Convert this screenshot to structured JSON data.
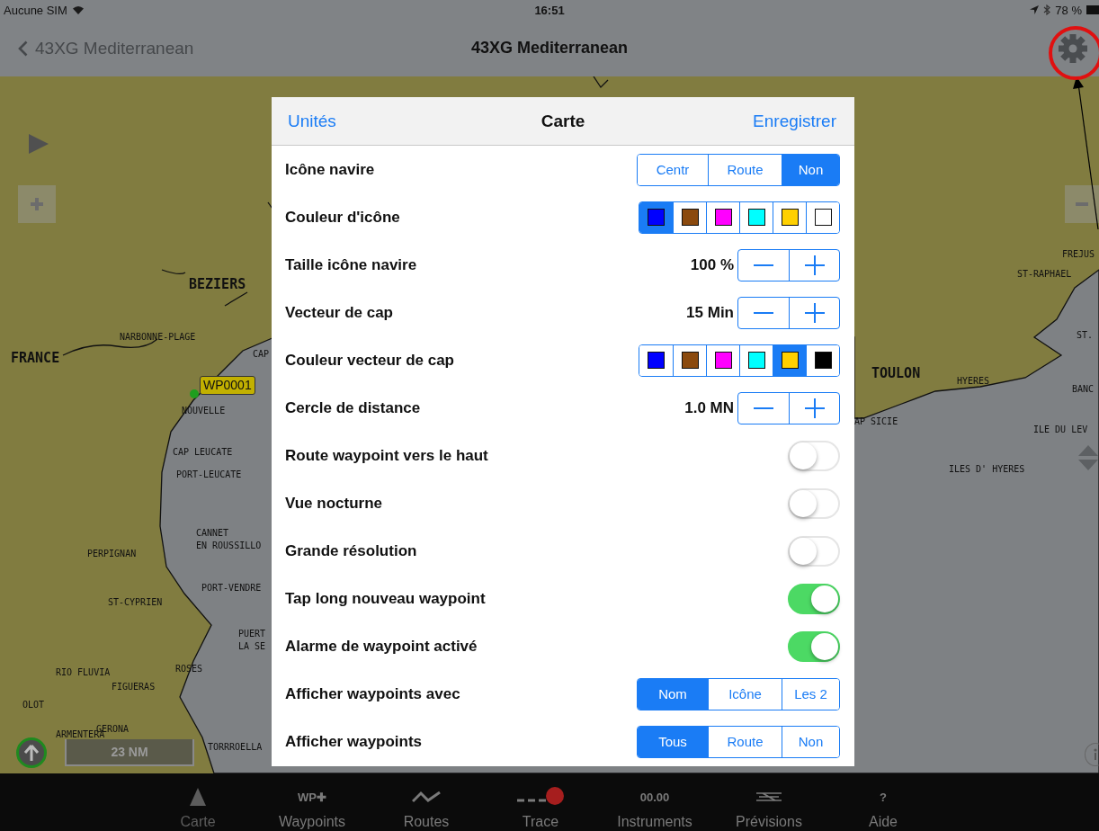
{
  "status_bar": {
    "carrier": "Aucune SIM",
    "time": "16:51",
    "battery": "78 %"
  },
  "nav_bar": {
    "back_label": "43XG Mediterranean",
    "title": "43XG Mediterranean"
  },
  "map": {
    "labels": [
      {
        "text": "BEZIERS",
        "kind": "city"
      },
      {
        "text": "NARBONNE-PLAGE",
        "kind": "place"
      },
      {
        "text": "FRANCE",
        "kind": "city"
      },
      {
        "text": "CAP",
        "kind": "place"
      },
      {
        "text": "NOUVELLE",
        "kind": "place"
      },
      {
        "text": "CAP LEUCATE",
        "kind": "place"
      },
      {
        "text": "PORT-LEUCATE",
        "kind": "place"
      },
      {
        "text": "CANNET",
        "kind": "place"
      },
      {
        "text": "EN ROUSSILLO",
        "kind": "place"
      },
      {
        "text": "PERPIGNAN",
        "kind": "place"
      },
      {
        "text": "PORT-VENDRE",
        "kind": "place"
      },
      {
        "text": "ST-CYPRIEN",
        "kind": "place"
      },
      {
        "text": "PUERT",
        "kind": "place"
      },
      {
        "text": "LA SE",
        "kind": "place"
      },
      {
        "text": "RIO FLUVIA",
        "kind": "place"
      },
      {
        "text": "FIGUERAS",
        "kind": "place"
      },
      {
        "text": "ROSES",
        "kind": "place"
      },
      {
        "text": "OLOT",
        "kind": "place"
      },
      {
        "text": "ARMENTERA",
        "kind": "place"
      },
      {
        "text": "GERONA",
        "kind": "place"
      },
      {
        "text": "TORRROELLA",
        "kind": "place"
      },
      {
        "text": "FREJUS",
        "kind": "place"
      },
      {
        "text": "ST-RAPHAEL",
        "kind": "place"
      },
      {
        "text": "ST.",
        "kind": "place"
      },
      {
        "text": "TOULON",
        "kind": "city"
      },
      {
        "text": "HYERES",
        "kind": "place"
      },
      {
        "text": "BANC",
        "kind": "place"
      },
      {
        "text": "AP SICIE",
        "kind": "place"
      },
      {
        "text": "ILE DU LEV",
        "kind": "place"
      },
      {
        "text": "ILES D' HYERES",
        "kind": "place"
      }
    ],
    "waypoint": "WP0001",
    "scale": "23 NM"
  },
  "popover": {
    "left_button": "Unités",
    "title": "Carte",
    "right_button": "Enregistrer",
    "rows": [
      {
        "kind": "segmented",
        "label": "Icône navire",
        "options": [
          {
            "label": "Centr",
            "selected": false
          },
          {
            "label": "Route",
            "selected": false
          },
          {
            "label": "Non",
            "selected": true
          }
        ]
      },
      {
        "kind": "colors",
        "label": "Couleur d'icône",
        "swatches": [
          {
            "color": "#0000ff",
            "selected": true
          },
          {
            "color": "#8b4a0e",
            "selected": false
          },
          {
            "color": "#ff00ff",
            "selected": false
          },
          {
            "color": "#00ffff",
            "selected": false
          },
          {
            "color": "#ffd000",
            "selected": false
          },
          {
            "color": "#ffffff",
            "selected": false
          }
        ]
      },
      {
        "kind": "stepper",
        "label": "Taille icône navire",
        "value": "100 %"
      },
      {
        "kind": "stepper",
        "label": "Vecteur de cap",
        "value": "15 Min"
      },
      {
        "kind": "colors",
        "label": "Couleur vecteur de cap",
        "swatches": [
          {
            "color": "#0000ff",
            "selected": false
          },
          {
            "color": "#8b4a0e",
            "selected": false
          },
          {
            "color": "#ff00ff",
            "selected": false
          },
          {
            "color": "#00ffff",
            "selected": false
          },
          {
            "color": "#ffd000",
            "selected": true
          },
          {
            "color": "#000000",
            "selected": false
          }
        ]
      },
      {
        "kind": "stepper",
        "label": "Cercle de distance",
        "value": "1.0 MN"
      },
      {
        "kind": "toggle",
        "label": "Route waypoint vers le haut",
        "on": false
      },
      {
        "kind": "toggle",
        "label": "Vue nocturne",
        "on": false
      },
      {
        "kind": "toggle",
        "label": "Grande résolution",
        "on": false
      },
      {
        "kind": "toggle",
        "label": "Tap long nouveau waypoint",
        "on": true
      },
      {
        "kind": "toggle",
        "label": "Alarme de waypoint activé",
        "on": true
      },
      {
        "kind": "segmented",
        "label": "Afficher waypoints avec",
        "options": [
          {
            "label": "Nom",
            "selected": true
          },
          {
            "label": "Icône",
            "selected": false
          },
          {
            "label": "Les 2",
            "selected": false
          }
        ]
      },
      {
        "kind": "segmented",
        "label": "Afficher waypoints",
        "options": [
          {
            "label": "Tous",
            "selected": true
          },
          {
            "label": "Route",
            "selected": false
          },
          {
            "label": "Non",
            "selected": false
          }
        ]
      }
    ]
  },
  "tab_bar": [
    {
      "kind": "triangle",
      "label": "Carte",
      "selected": true
    },
    {
      "kind": "text",
      "icon_text": "WP✚",
      "label": "Waypoints",
      "selected": false
    },
    {
      "kind": "zigzag",
      "label": "Routes",
      "selected": false
    },
    {
      "kind": "trace",
      "label": "Trace",
      "selected": false
    },
    {
      "kind": "text",
      "icon_text": "00.00",
      "label": "Instruments",
      "selected": false
    },
    {
      "kind": "forecast",
      "label": "Prévisions",
      "selected": false
    },
    {
      "kind": "text",
      "icon_text": "?",
      "label": "Aide",
      "selected": false
    }
  ]
}
